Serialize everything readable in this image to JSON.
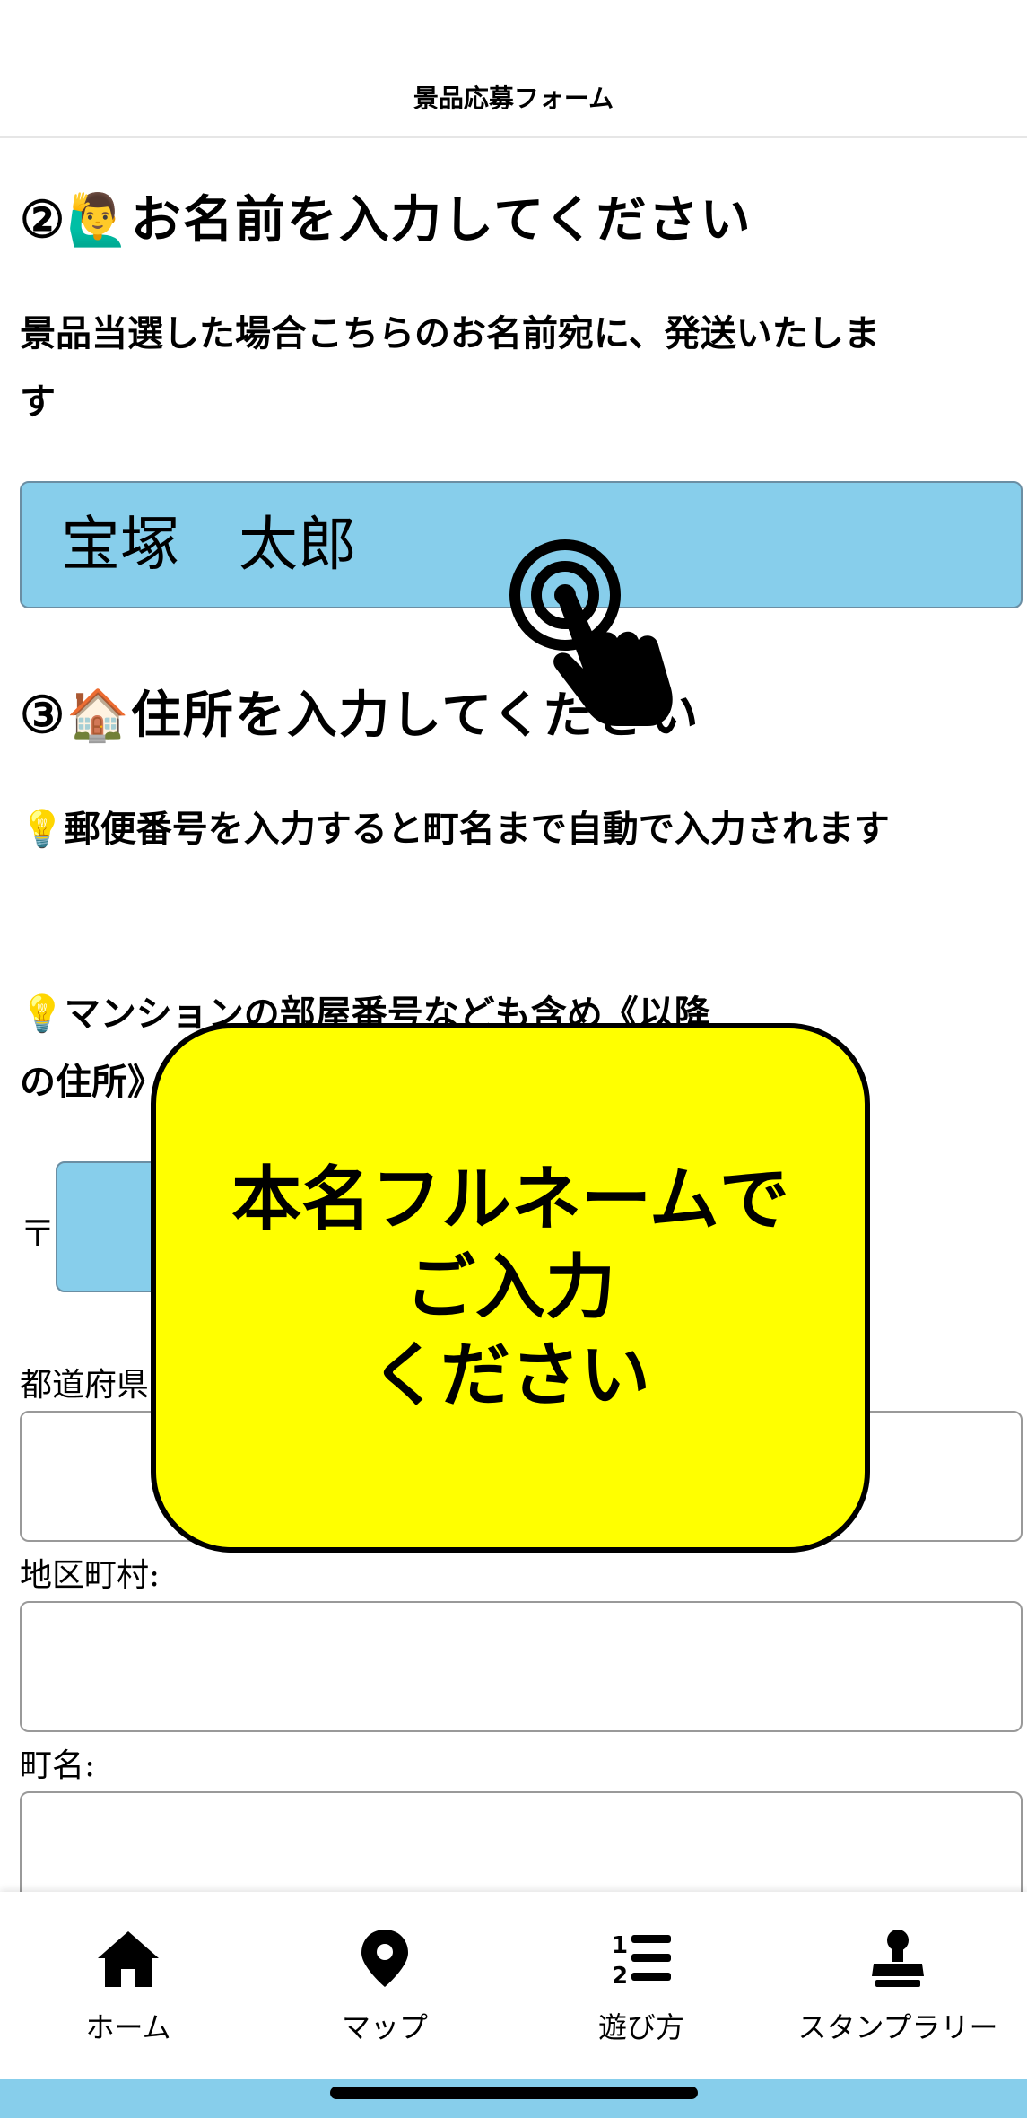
{
  "header": {
    "title": "景品応募フォーム"
  },
  "name_section": {
    "heading": "②🙋‍♂️お名前を入力してください",
    "note": "景品当選した場合こちらのお名前宛に、発送いたします",
    "name_value": "宝塚　太郎"
  },
  "address_section": {
    "heading": "③🏠住所を入力してください",
    "note1": "💡郵便番号を入力すると町名まで自動で入力されます",
    "note2_line1": "💡マンションの部屋番号なども含め《以降",
    "note2_line2": "の住所》",
    "zip_mark": "〒",
    "prefecture_label": "都道府県:",
    "city_label": "地区町村:",
    "town_label": "町名:"
  },
  "popup": {
    "text": "本名フルネームで\nご入力\nください",
    "color": "#ffff00"
  },
  "tabs": [
    {
      "label": "ホーム",
      "icon": "home-icon"
    },
    {
      "label": "マップ",
      "icon": "map-pin-icon"
    },
    {
      "label": "遊び方",
      "icon": "list-ordered-icon"
    },
    {
      "label": "スタンプラリー",
      "icon": "stamp-icon"
    }
  ],
  "colors": {
    "input_fill": "#87ceeb",
    "accent": "#ffff00"
  }
}
